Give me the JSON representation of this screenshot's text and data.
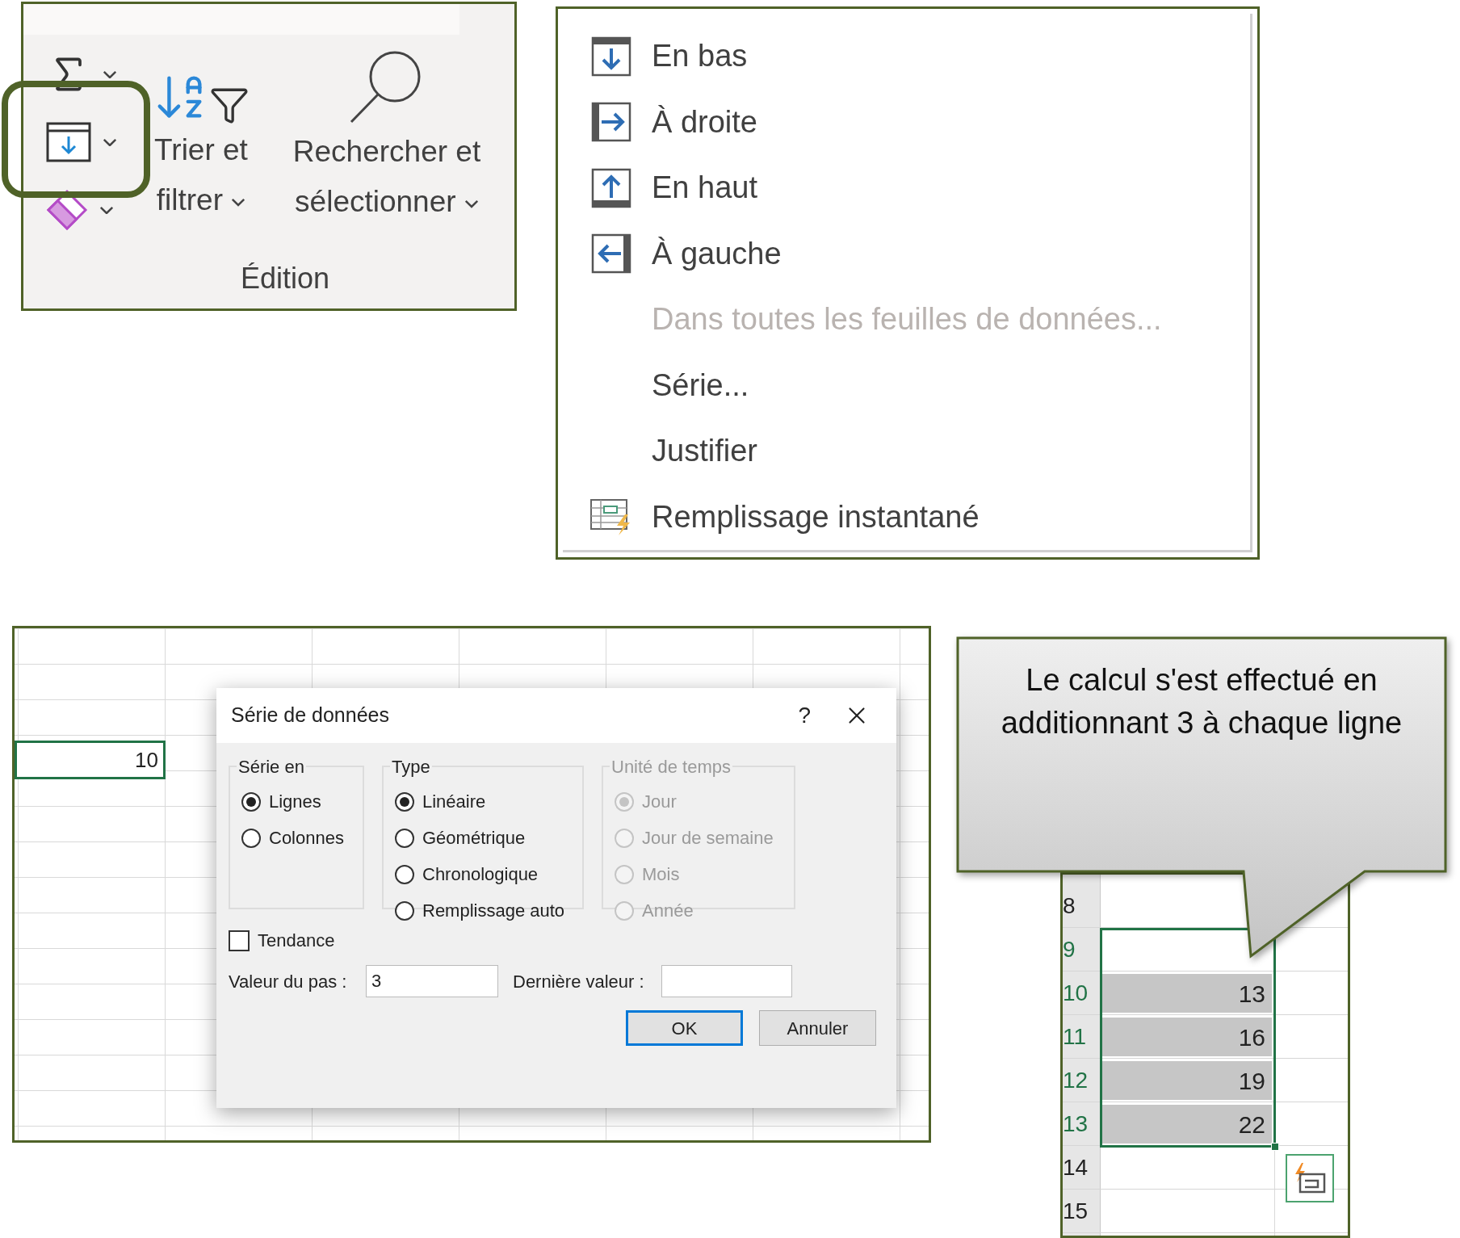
{
  "ribbon": {
    "tools": [
      {
        "kind": "autosum"
      },
      {
        "kind": "fill"
      },
      {
        "kind": "clear"
      }
    ],
    "sort_label": "Trier et filtrer",
    "find_label": "Rechercher et sélectionner",
    "group_label": "Édition"
  },
  "fill_menu": {
    "items": [
      {
        "label": "En bas",
        "kind": "down",
        "disabled": false
      },
      {
        "label": "À droite",
        "kind": "right",
        "disabled": false
      },
      {
        "label": "En haut",
        "kind": "up",
        "disabled": false
      },
      {
        "label": "À gauche",
        "kind": "left",
        "disabled": false
      },
      {
        "label": "Dans toutes les feuilles de données...",
        "kind": "none",
        "disabled": true
      },
      {
        "label": "Série...",
        "kind": "none",
        "disabled": false
      },
      {
        "label": "Justifier",
        "kind": "none",
        "disabled": false
      },
      {
        "label": "Remplissage instantané",
        "kind": "flash",
        "disabled": false
      }
    ]
  },
  "series_sheet": {
    "cell_value": "10",
    "dialog": {
      "title": "Série de données",
      "help": "?",
      "groups": [
        {
          "title": "Série en",
          "disabled": false,
          "options": [
            {
              "label": "Lignes",
              "selected": true
            },
            {
              "label": "Colonnes",
              "selected": false
            }
          ]
        },
        {
          "title": "Type",
          "disabled": false,
          "options": [
            {
              "label": "Linéaire",
              "selected": true
            },
            {
              "label": "Géométrique",
              "selected": false
            },
            {
              "label": "Chronologique",
              "selected": false
            },
            {
              "label": "Remplissage auto",
              "selected": false
            }
          ]
        },
        {
          "title": "Unité de temps",
          "disabled": true,
          "options": [
            {
              "label": "Jour",
              "selected": true
            },
            {
              "label": "Jour de semaine",
              "selected": false
            },
            {
              "label": "Mois",
              "selected": false
            },
            {
              "label": "Année",
              "selected": false
            }
          ]
        }
      ],
      "trend": {
        "label": "Tendance",
        "checked": false
      },
      "step": {
        "label": "Valeur du pas :",
        "value": "3"
      },
      "stop": {
        "label": "Dernière valeur :"
      },
      "buttons": [
        {
          "label": "OK",
          "default": true
        },
        {
          "label": "Annuler",
          "default": false
        }
      ]
    }
  },
  "result_sheet": {
    "rows": [
      {
        "number": "8",
        "selected": false,
        "highlighted": false
      },
      {
        "number": "9",
        "selected": true,
        "highlighted": false
      },
      {
        "number": "10",
        "value": "13",
        "selected": true,
        "highlighted": true
      },
      {
        "number": "11",
        "value": "16",
        "selected": true,
        "highlighted": true
      },
      {
        "number": "12",
        "value": "19",
        "selected": true,
        "highlighted": true
      },
      {
        "number": "13",
        "value": "22",
        "selected": true,
        "highlighted": true
      },
      {
        "number": "14",
        "selected": false,
        "highlighted": false
      },
      {
        "number": "15",
        "selected": false,
        "highlighted": false
      }
    ]
  },
  "callout": {
    "text": "Le calcul s'est effectué en additionnant 3 à chaque ligne"
  }
}
